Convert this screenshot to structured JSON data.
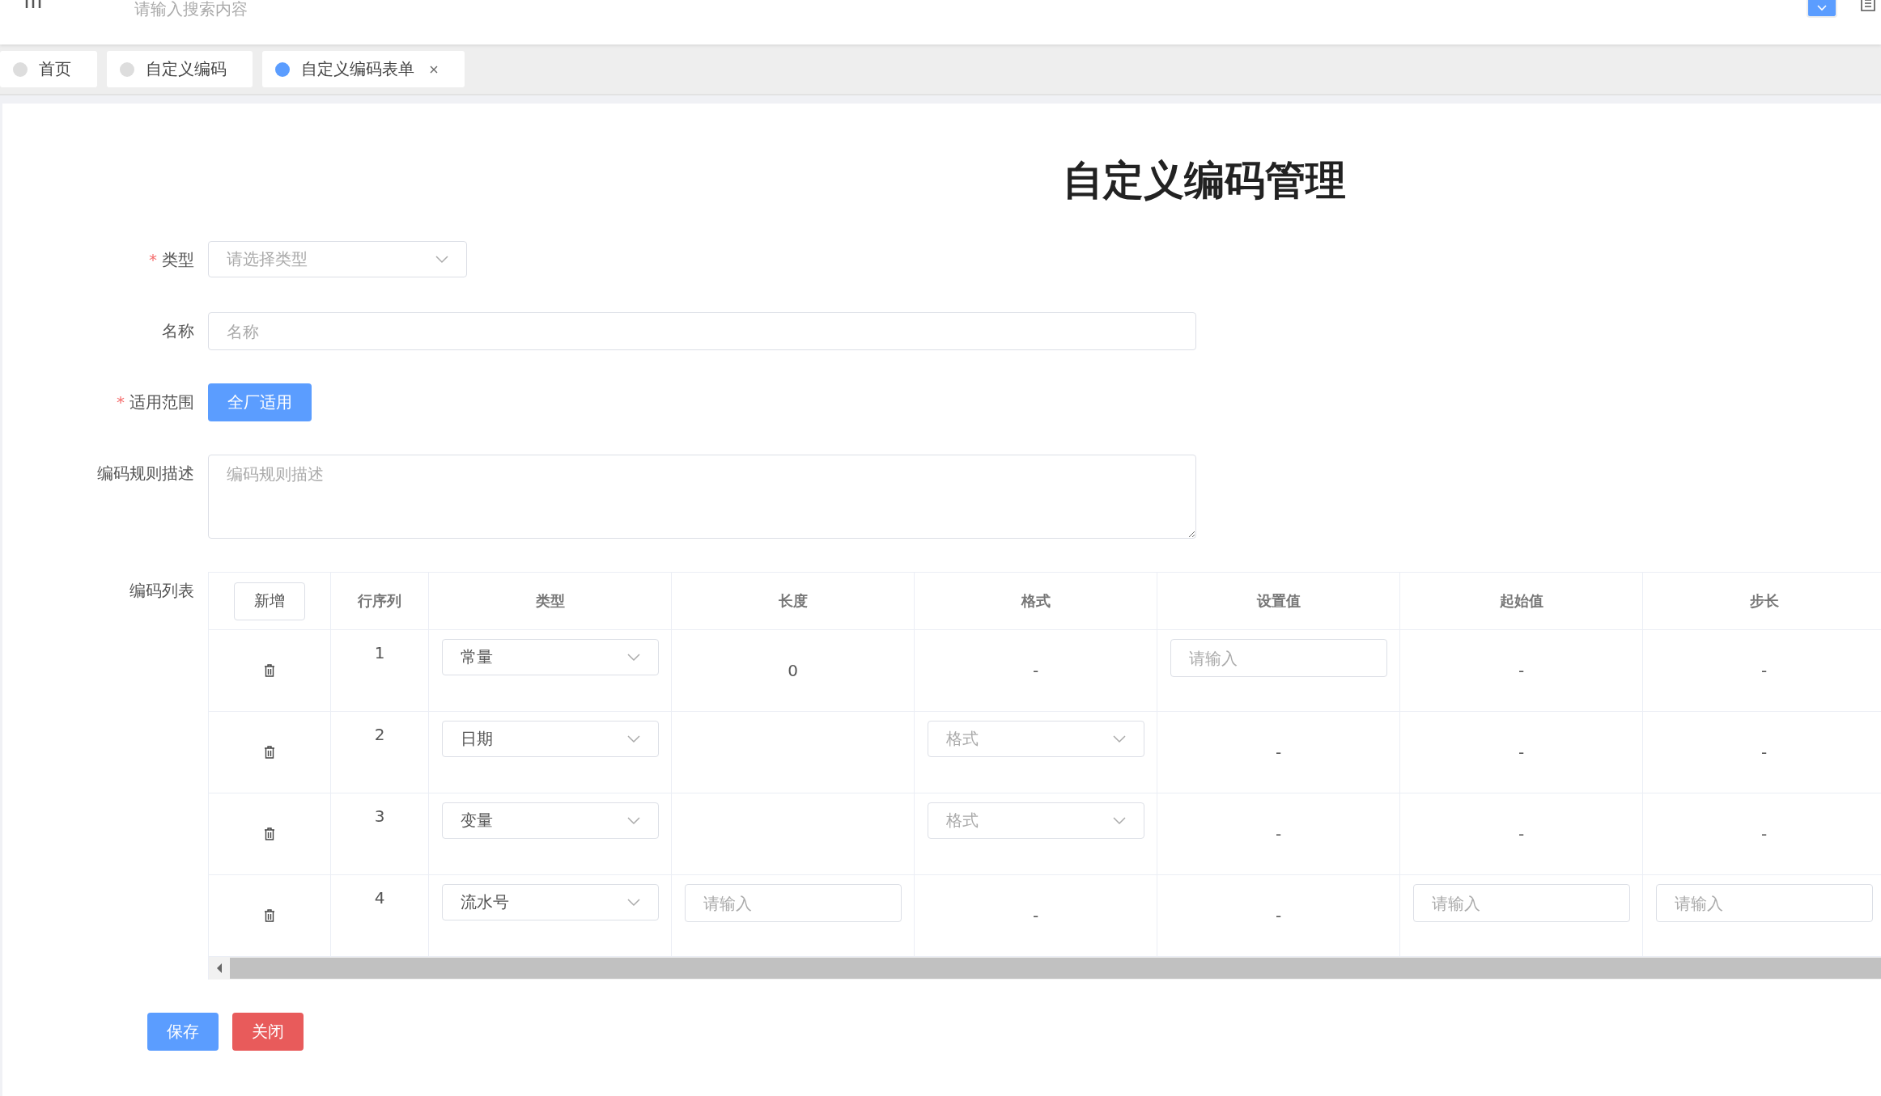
{
  "header": {
    "search_placeholder": "请输入搜索内容"
  },
  "tabs": [
    {
      "label": "首页",
      "selected": false,
      "closable": false
    },
    {
      "label": "自定义编码",
      "selected": false,
      "closable": false
    },
    {
      "label": "自定义编码表单",
      "selected": true,
      "closable": true
    }
  ],
  "title": "自定义编码管理",
  "form": [
    {
      "kind": "select",
      "marker": "*",
      "label": "类型",
      "placeholder": "请选择类型"
    },
    {
      "kind": "input",
      "label": "名称",
      "placeholder": "名称"
    },
    {
      "kind": "button",
      "marker": "*",
      "label": "适用范围",
      "text": "全厂适用"
    },
    {
      "kind": "textarea",
      "label": "编码规则描述",
      "placeholder": "编码规则描述"
    }
  ],
  "code_list": {
    "label": "编码列表",
    "columns": [
      {
        "kind": "button",
        "label": "新增"
      },
      {
        "kind": "text",
        "label": "行序列"
      },
      {
        "kind": "text",
        "label": "类型"
      },
      {
        "kind": "text",
        "label": "长度"
      },
      {
        "kind": "text",
        "label": "格式"
      },
      {
        "kind": "text",
        "label": "设置值"
      },
      {
        "kind": "text",
        "label": "起始值"
      },
      {
        "kind": "text",
        "label": "步长"
      }
    ],
    "rows": [
      {
        "cells": [
          {
            "kind": "delete"
          },
          {
            "kind": "seq",
            "text": "1"
          },
          {
            "kind": "select",
            "value": "常量"
          },
          {
            "kind": "text",
            "text": "0"
          },
          {
            "kind": "text",
            "text": "-"
          },
          {
            "kind": "input",
            "placeholder": "请输入"
          },
          {
            "kind": "text",
            "text": "-"
          },
          {
            "kind": "text",
            "text": "-"
          }
        ]
      },
      {
        "cells": [
          {
            "kind": "delete"
          },
          {
            "kind": "seq",
            "text": "2"
          },
          {
            "kind": "select",
            "value": "日期"
          },
          {
            "kind": "empty"
          },
          {
            "kind": "select",
            "placeholder": "格式"
          },
          {
            "kind": "text",
            "text": "-"
          },
          {
            "kind": "text",
            "text": "-"
          },
          {
            "kind": "text",
            "text": "-"
          }
        ]
      },
      {
        "cells": [
          {
            "kind": "delete"
          },
          {
            "kind": "seq",
            "text": "3"
          },
          {
            "kind": "select",
            "value": "变量"
          },
          {
            "kind": "empty"
          },
          {
            "kind": "select",
            "placeholder": "格式"
          },
          {
            "kind": "text",
            "text": "-"
          },
          {
            "kind": "text",
            "text": "-"
          },
          {
            "kind": "text",
            "text": "-"
          }
        ]
      },
      {
        "cells": [
          {
            "kind": "delete"
          },
          {
            "kind": "seq",
            "text": "4"
          },
          {
            "kind": "select",
            "value": "流水号"
          },
          {
            "kind": "input",
            "placeholder": "请输入"
          },
          {
            "kind": "text",
            "text": "-"
          },
          {
            "kind": "text",
            "text": "-"
          },
          {
            "kind": "input",
            "placeholder": "请输入"
          },
          {
            "kind": "input",
            "placeholder": "请输入"
          }
        ]
      }
    ]
  },
  "buttons": [
    {
      "label": "保存",
      "kind": "primary"
    },
    {
      "label": "关闭",
      "kind": "danger"
    }
  ]
}
